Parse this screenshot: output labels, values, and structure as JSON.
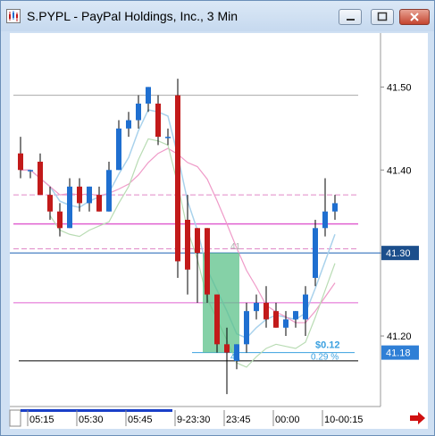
{
  "window": {
    "title": "S.PYPL - PayPal Holdings, Inc., 3 Min",
    "controls": [
      "minimize",
      "maximize",
      "close"
    ],
    "icon": "chart-icon"
  },
  "chart_data": {
    "type": "candlestick",
    "symbol": "S.PYPL",
    "interval": "3 Min",
    "price_axis": {
      "ylim": [
        41.115,
        41.565
      ],
      "ticks": [
        "41.50",
        "41.40",
        "41.30",
        "41.20"
      ],
      "last_price_tag": "41.30",
      "last_price_value": 41.3,
      "stop_price_tag": "41.18",
      "stop_price_value": 41.18
    },
    "time_axis": {
      "labels": [
        {
          "label": "05:15",
          "bar": 0
        },
        {
          "label": "05:30",
          "bar": 5
        },
        {
          "label": "05:45",
          "bar": 10
        },
        {
          "label": "9-23:30",
          "bar": 15
        },
        {
          "label": "23:45",
          "bar": 20
        },
        {
          "label": "00:00",
          "bar": 25
        },
        {
          "label": "10-00:15",
          "bar": 30
        }
      ]
    },
    "candles": [
      {
        "o": 41.42,
        "h": 41.44,
        "l": 41.39,
        "c": 41.4
      },
      {
        "o": 41.4,
        "h": 41.4,
        "l": 41.39,
        "c": 41.4
      },
      {
        "o": 41.41,
        "h": 41.42,
        "l": 41.37,
        "c": 41.37
      },
      {
        "o": 41.37,
        "h": 41.38,
        "l": 41.34,
        "c": 41.35
      },
      {
        "o": 41.35,
        "h": 41.36,
        "l": 41.32,
        "c": 41.33
      },
      {
        "o": 41.33,
        "h": 41.39,
        "l": 41.33,
        "c": 41.38
      },
      {
        "o": 41.38,
        "h": 41.39,
        "l": 41.35,
        "c": 41.36
      },
      {
        "o": 41.36,
        "h": 41.38,
        "l": 41.35,
        "c": 41.38
      },
      {
        "o": 41.37,
        "h": 41.38,
        "l": 41.35,
        "c": 41.35
      },
      {
        "o": 41.35,
        "h": 41.41,
        "l": 41.35,
        "c": 41.4
      },
      {
        "o": 41.4,
        "h": 41.46,
        "l": 41.4,
        "c": 41.45
      },
      {
        "o": 41.45,
        "h": 41.47,
        "l": 41.44,
        "c": 41.46
      },
      {
        "o": 41.46,
        "h": 41.49,
        "l": 41.45,
        "c": 41.48
      },
      {
        "o": 41.48,
        "h": 41.5,
        "l": 41.47,
        "c": 41.5
      },
      {
        "o": 41.48,
        "h": 41.49,
        "l": 41.43,
        "c": 41.44
      },
      {
        "o": 41.44,
        "h": 41.45,
        "l": 41.43,
        "c": 41.44
      },
      {
        "o": 41.49,
        "h": 41.51,
        "l": 41.27,
        "c": 41.29
      },
      {
        "o": 41.34,
        "h": 41.37,
        "l": 41.25,
        "c": 41.28
      },
      {
        "o": 41.33,
        "h": 41.33,
        "l": 41.24,
        "c": 41.3
      },
      {
        "o": 41.33,
        "h": 41.33,
        "l": 41.24,
        "c": 41.25
      },
      {
        "o": 41.25,
        "h": 41.25,
        "l": 41.18,
        "c": 41.19
      },
      {
        "o": 41.19,
        "h": 41.21,
        "l": 41.13,
        "c": 41.18
      },
      {
        "o": 41.17,
        "h": 41.19,
        "l": 41.16,
        "c": 41.19
      },
      {
        "o": 41.19,
        "h": 41.24,
        "l": 41.18,
        "c": 41.23
      },
      {
        "o": 41.23,
        "h": 41.25,
        "l": 41.22,
        "c": 41.24
      },
      {
        "o": 41.24,
        "h": 41.26,
        "l": 41.21,
        "c": 41.22
      },
      {
        "o": 41.23,
        "h": 41.24,
        "l": 41.21,
        "c": 41.21
      },
      {
        "o": 41.21,
        "h": 41.23,
        "l": 41.2,
        "c": 41.22
      },
      {
        "o": 41.22,
        "h": 41.23,
        "l": 41.21,
        "c": 41.23
      },
      {
        "o": 41.22,
        "h": 41.26,
        "l": 41.2,
        "c": 41.25
      },
      {
        "o": 41.27,
        "h": 41.34,
        "l": 41.26,
        "c": 41.33
      },
      {
        "o": 41.33,
        "h": 41.39,
        "l": 41.32,
        "c": 41.35
      },
      {
        "o": 41.35,
        "h": 41.37,
        "l": 41.34,
        "c": 41.36
      }
    ],
    "reference_lines": [
      {
        "name": "upper-resistance",
        "value": 41.49,
        "color": "#a8a8a8",
        "style": "solid"
      },
      {
        "name": "pink-level-1",
        "value": 41.37,
        "color": "#e089c8",
        "style": "dashed"
      },
      {
        "name": "pink-level-2",
        "value": 41.335,
        "color": "#e060d0",
        "style": "solid"
      },
      {
        "name": "pink-level-3",
        "value": 41.305,
        "color": "#e089c8",
        "style": "dashed"
      },
      {
        "name": "current-price",
        "value": 41.3,
        "color": "#1a5fb4",
        "style": "solid"
      },
      {
        "name": "pink-level-4",
        "value": 41.24,
        "color": "#e060d0",
        "style": "solid"
      },
      {
        "name": "stop-level",
        "value": 41.18,
        "color": "#3aa0e0",
        "style": "solid"
      },
      {
        "name": "black-level",
        "value": 41.17,
        "color": "#000000",
        "style": "solid"
      }
    ],
    "position_box": {
      "from_bar": 19,
      "to_bar": 22,
      "top": 41.3,
      "bottom": 41.18,
      "color": "#5cc28a",
      "entry_label": "41",
      "profit_label": "$0.12",
      "percent_label": "0.29 %"
    },
    "indicators": [
      "light-blue-moving-average",
      "pink-moving-average",
      "light-green-band"
    ],
    "colors": {
      "up": "#1f6fd0",
      "down": "#c21a1a",
      "background": "#ffffff"
    }
  },
  "icons": {
    "scroll_arrow": "red-right-arrow-icon"
  }
}
